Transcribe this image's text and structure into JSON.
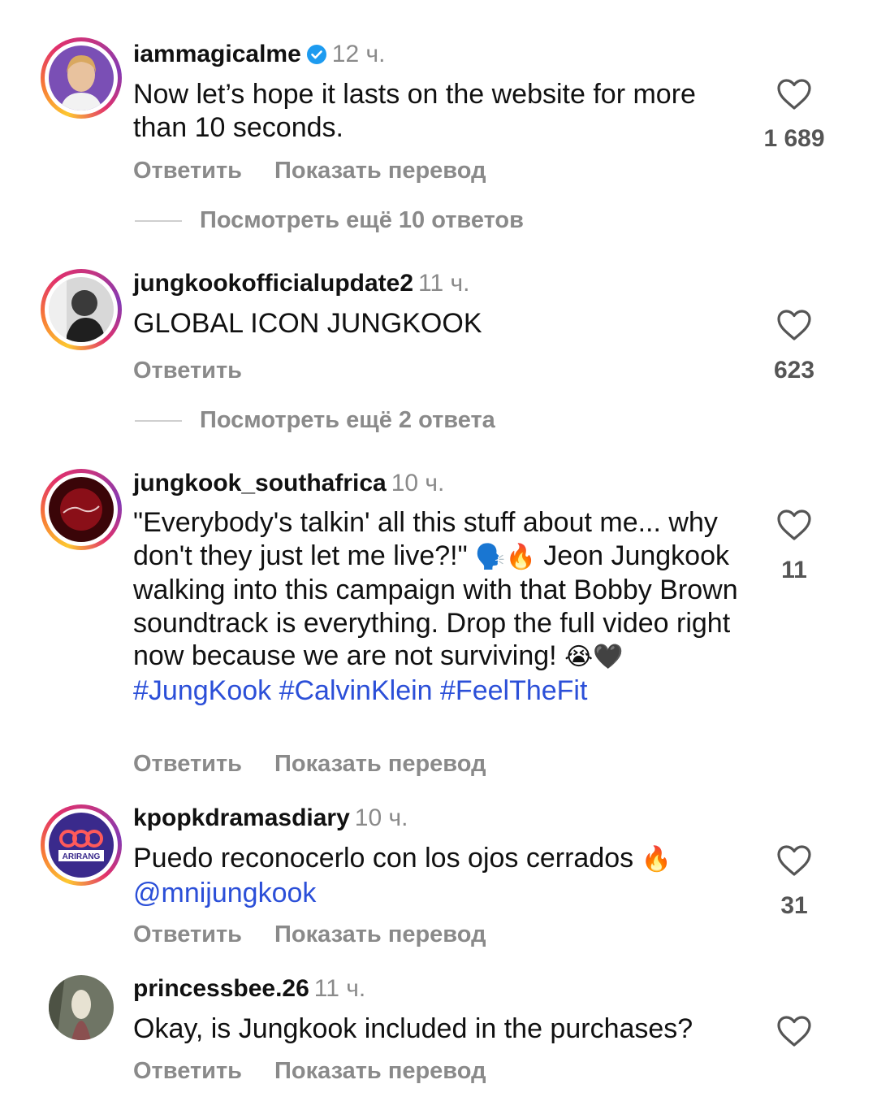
{
  "comments": [
    {
      "username": "iammagicalme",
      "time": "12 ч.",
      "verified": true,
      "text": "Now let’s hope it lasts on the website for more than 10 seconds.",
      "reply_label": "Ответить",
      "translate_label": "Показать перевод",
      "likes": "1 689",
      "view_replies": "Посмотреть ещё 10 ответов"
    },
    {
      "username": "jungkookofficialupdate2",
      "time": "11 ч.",
      "text": "GLOBAL ICON JUNGKOOK",
      "reply_label": "Ответить",
      "likes": "623",
      "view_replies": "Посмотреть ещё 2 ответа"
    },
    {
      "username": "jungkook_southafrica",
      "time": "10 ч.",
      "text_part1": "\"Everybody's talkin' all this stuff about me... why don't they just let me live?!\"",
      "emoji1": "🗣️🔥",
      "text_part2": "Jeon Jungkook walking into this campaign with that Bobby Brown soundtrack is everything. Drop the full video right now because we are not surviving!",
      "emoji2": "😭🖤",
      "hashtags": "#JungKook #CalvinKlein #FeelTheFit",
      "reply_label": "Ответить",
      "translate_label": "Показать перевод",
      "likes": "11"
    },
    {
      "username": "kpopkdramasdiary",
      "time": "10 ч.",
      "text": "Puedo reconocerlo con los ojos cerrados",
      "emoji": "🔥",
      "mention": "@mnijungkook",
      "reply_label": "Ответить",
      "translate_label": "Показать перевод",
      "likes": "31",
      "avatar_text": "ARIRANG"
    },
    {
      "username": "princessbee.26",
      "time": "11 ч.",
      "text": "Okay, is Jungkook included in the purchases?",
      "reply_label": "Ответить",
      "translate_label": "Показать перевод"
    }
  ],
  "colors": {
    "link": "#2b4fd8",
    "muted": "#8a8a8a",
    "verified": "#1d9bf0"
  }
}
